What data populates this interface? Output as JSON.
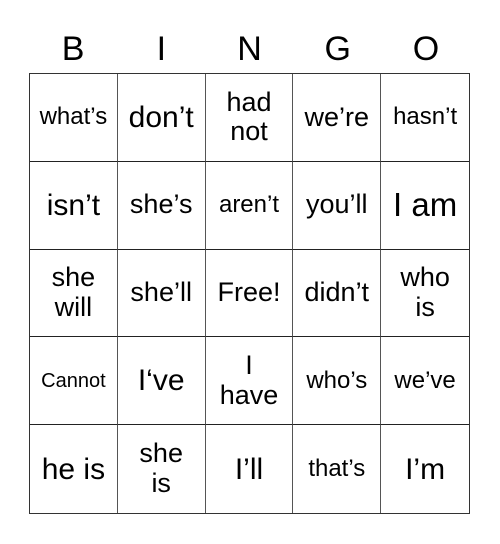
{
  "header": [
    "B",
    "I",
    "N",
    "G",
    "O"
  ],
  "cells": [
    {
      "text": "what’s",
      "size": "s-s"
    },
    {
      "text": "don’t",
      "size": "s-l"
    },
    {
      "text": "had\nnot",
      "size": "s-m"
    },
    {
      "text": "we’re",
      "size": "s-m"
    },
    {
      "text": "hasn’t",
      "size": "s-s"
    },
    {
      "text": "isn’t",
      "size": "s-l"
    },
    {
      "text": "she’s",
      "size": "s-m"
    },
    {
      "text": "aren’t",
      "size": "s-s"
    },
    {
      "text": "you’ll",
      "size": "s-m"
    },
    {
      "text": "I am",
      "size": "s-xl"
    },
    {
      "text": "she\nwill",
      "size": "s-m"
    },
    {
      "text": "she’ll",
      "size": "s-m"
    },
    {
      "text": "Free!",
      "size": "s-m"
    },
    {
      "text": "didn’t",
      "size": "s-m"
    },
    {
      "text": "who\nis",
      "size": "s-m"
    },
    {
      "text": "Cannot",
      "size": "s-xs"
    },
    {
      "text": "I‘ve",
      "size": "s-l"
    },
    {
      "text": "I\nhave",
      "size": "s-m"
    },
    {
      "text": "who’s",
      "size": "s-s"
    },
    {
      "text": "we’ve",
      "size": "s-s"
    },
    {
      "text": "he is",
      "size": "s-l"
    },
    {
      "text": "she\nis",
      "size": "s-m"
    },
    {
      "text": "I’ll",
      "size": "s-l"
    },
    {
      "text": "that’s",
      "size": "s-s"
    },
    {
      "text": "I’m",
      "size": "s-l"
    }
  ]
}
